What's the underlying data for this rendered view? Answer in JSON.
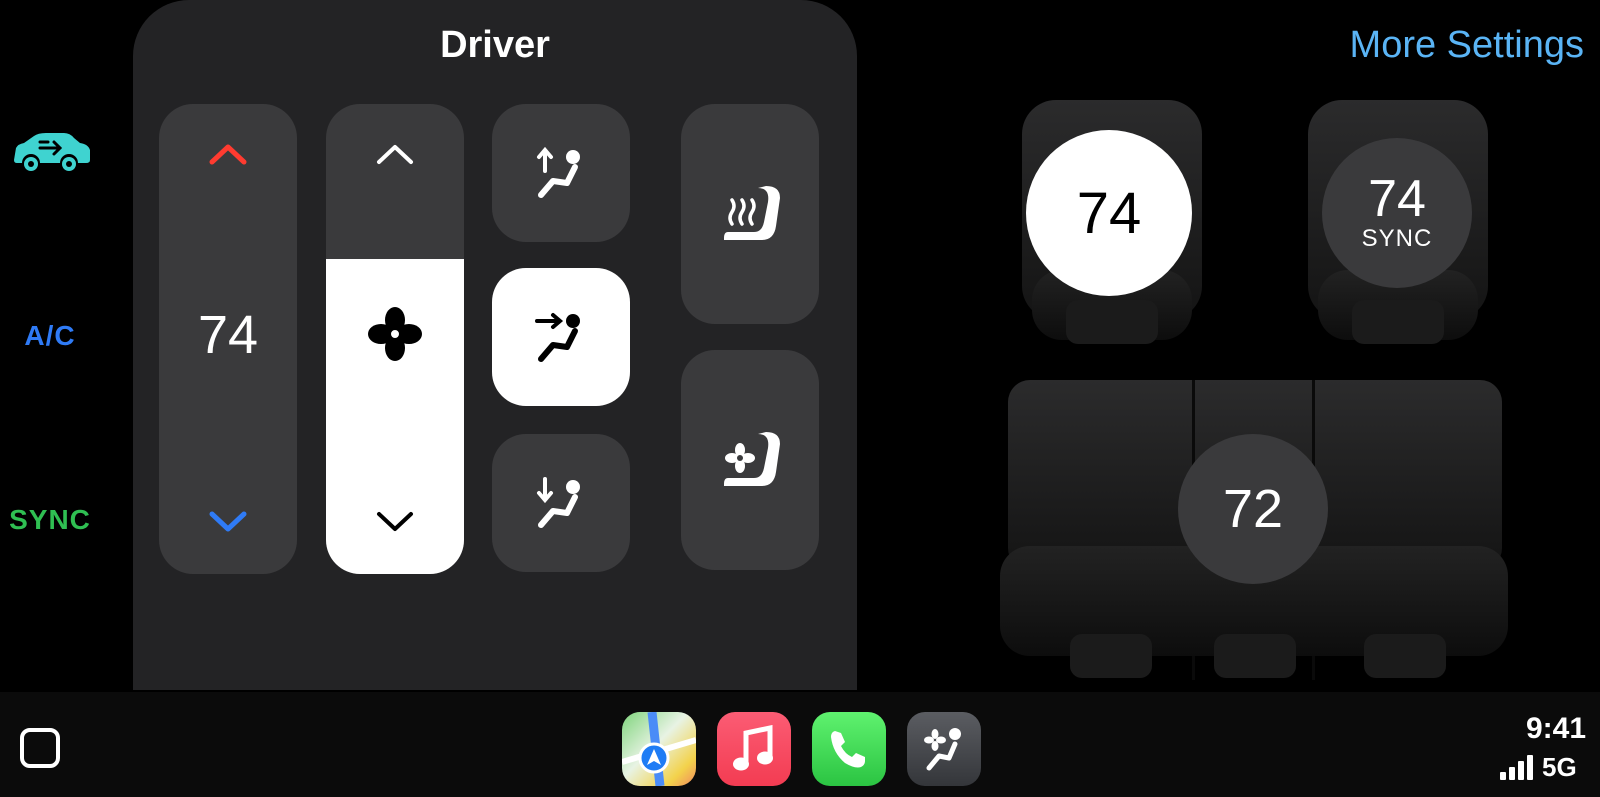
{
  "sidebar": {
    "car_icon": "car-recirculation-icon",
    "ac_label": "A/C",
    "sync_label": "SYNC",
    "colors": {
      "car": "#3fd3d0",
      "ac": "#2f7bf6",
      "sync": "#2fbf52"
    }
  },
  "driver_panel": {
    "title": "Driver",
    "temperature": "74",
    "fan_level_fraction": 0.67,
    "airflow_modes": [
      "vent-up-icon",
      "vent-face-icon",
      "vent-down-icon"
    ],
    "selected_airflow": "vent-face-icon",
    "seat_controls": [
      "seat-heat-icon",
      "seat-cool-icon"
    ]
  },
  "header": {
    "more_settings": "More Settings",
    "more_settings_color": "#5ab4f5"
  },
  "seats": {
    "driver_temp": "74",
    "passenger_temp": "74",
    "passenger_sync": "SYNC",
    "rear_temp": "72"
  },
  "dock": {
    "apps": [
      "maps",
      "music",
      "phone",
      "climate"
    ],
    "time": "9:41",
    "network": "5G"
  }
}
